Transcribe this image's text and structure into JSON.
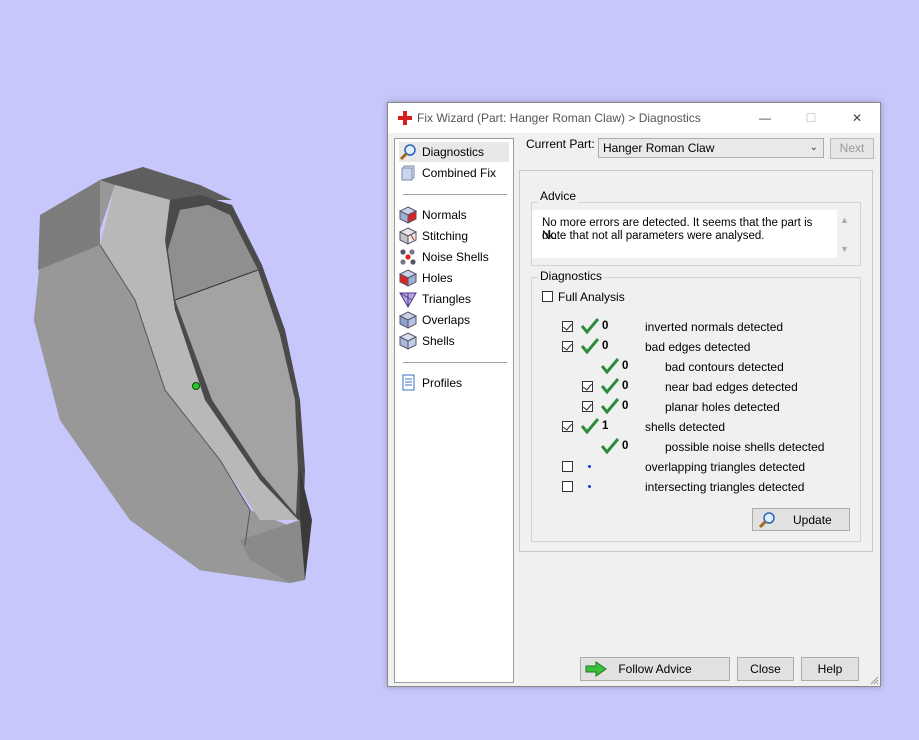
{
  "window": {
    "title": "Fix Wizard (Part: Hanger Roman Claw) > Diagnostics",
    "minimize_glyph": "—",
    "maximize_glyph": "☐",
    "close_glyph": "✕"
  },
  "nav": {
    "items": [
      {
        "label": "Diagnostics",
        "icon": "magnifier-icon",
        "selected": true
      },
      {
        "label": "Combined Fix",
        "icon": "layers-icon"
      },
      {
        "label": "Normals",
        "icon": "cube-red-icon"
      },
      {
        "label": "Stitching",
        "icon": "cube-stitch-icon"
      },
      {
        "label": "Noise Shells",
        "icon": "dots-icon"
      },
      {
        "label": "Holes",
        "icon": "cube-hole-icon"
      },
      {
        "label": "Triangles",
        "icon": "triangles-icon"
      },
      {
        "label": "Overlaps",
        "icon": "cube-overlap-icon"
      },
      {
        "label": "Shells",
        "icon": "cube-shell-icon"
      },
      {
        "label": "Profiles",
        "icon": "document-icon"
      }
    ]
  },
  "current_part": {
    "label": "Current Part:",
    "value": "Hanger Roman Claw",
    "next_label": "Next"
  },
  "advice": {
    "title": "Advice",
    "line1": "No more errors are detected. It seems that the part is ok.",
    "line2": "Note that not all parameters were analysed."
  },
  "diagnostics": {
    "title": "Diagnostics",
    "full_analysis_label": "Full Analysis",
    "rows": [
      {
        "checkbox": true,
        "ok": true,
        "count": "0",
        "label": "inverted normals detected"
      },
      {
        "checkbox": true,
        "ok": true,
        "count": "0",
        "label": "bad edges detected"
      },
      {
        "checkbox": null,
        "ok": true,
        "count": "0",
        "label": "bad contours detected"
      },
      {
        "checkbox": true,
        "ok": true,
        "count": "0",
        "label": "near bad edges detected"
      },
      {
        "checkbox": true,
        "ok": true,
        "count": "0",
        "label": "planar holes detected"
      },
      {
        "checkbox": true,
        "ok": true,
        "count": "1",
        "label": "shells detected"
      },
      {
        "checkbox": null,
        "ok": true,
        "count": "0",
        "label": "possible noise shells detected"
      },
      {
        "checkbox": false,
        "ok": false,
        "count": "",
        "label": "overlapping triangles detected"
      },
      {
        "checkbox": false,
        "ok": false,
        "count": "",
        "label": "intersecting triangles detected"
      }
    ],
    "update_label": "Update"
  },
  "footer": {
    "follow_advice_label": "Follow Advice",
    "close_label": "Close",
    "help_label": "Help"
  },
  "colors": {
    "background": "#c7c7fb",
    "model_face": "#a8a8a8",
    "check_green": "#2e8b3a",
    "status_dot_blue": "#1a3fd8"
  }
}
